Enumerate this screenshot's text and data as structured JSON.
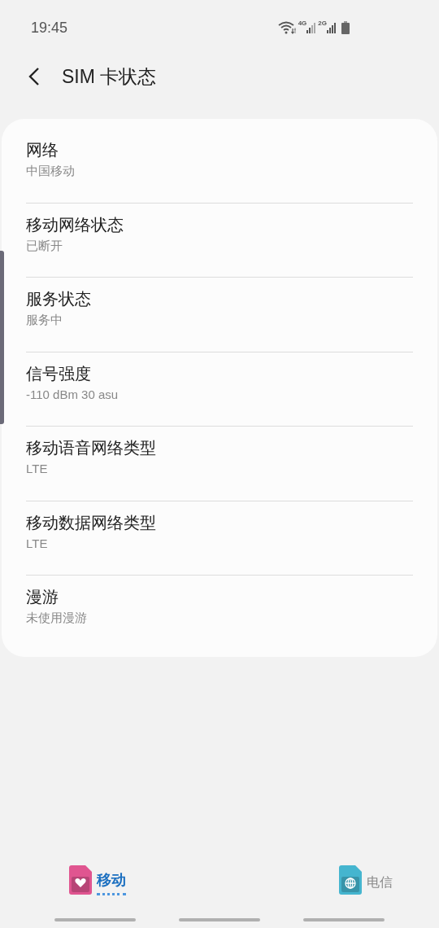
{
  "status_bar": {
    "time": "19:45",
    "networks": [
      {
        "label": "4G"
      },
      {
        "label": "2G"
      }
    ]
  },
  "header": {
    "title": "SIM 卡状态"
  },
  "items": [
    {
      "title": "网络",
      "value": "中国移动"
    },
    {
      "title": "移动网络状态",
      "value": "已断开"
    },
    {
      "title": "服务状态",
      "value": "服务中"
    },
    {
      "title": "信号强度",
      "value": "-110 dBm 30 asu"
    },
    {
      "title": "移动语音网络类型",
      "value": "LTE"
    },
    {
      "title": "移动数据网络类型",
      "value": "LTE"
    },
    {
      "title": "漫游",
      "value": "未使用漫游"
    }
  ],
  "sim_tabs": [
    {
      "label": "移动",
      "selected": true,
      "color": "#e05590",
      "kind": "heart"
    },
    {
      "label": "电信",
      "selected": false,
      "color": "#45b5cf",
      "kind": "globe"
    }
  ]
}
